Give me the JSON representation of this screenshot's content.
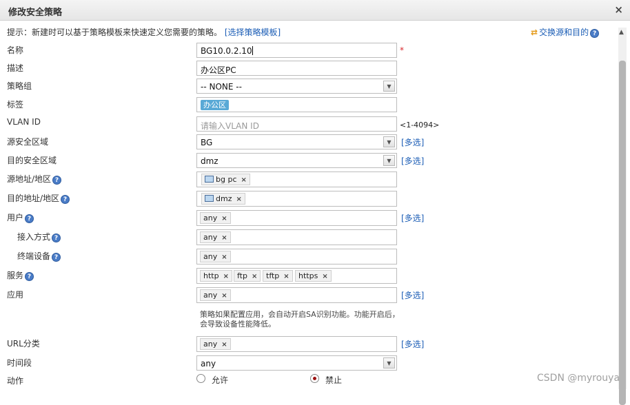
{
  "dialog": {
    "title": "修改安全策略",
    "close_icon": "×"
  },
  "hint": {
    "text": "提示：新建时可以基于策略模板来快速定义您需要的策略。",
    "link": "[选择策略模板]"
  },
  "swap_link": "交换源和目的",
  "help_glyph": "?",
  "fields": {
    "name": {
      "label": "名称",
      "value": "BG10.0.2.10",
      "required": "*"
    },
    "description": {
      "label": "描述",
      "value": "办公区PC"
    },
    "policy_group": {
      "label": "策略组",
      "value": "-- NONE --"
    },
    "tag": {
      "label": "标签",
      "value": "办公区"
    },
    "vlan": {
      "label": "VLAN ID",
      "placeholder": "请输入VLAN ID",
      "range": "<1-4094>"
    },
    "src_zone": {
      "label": "源安全区域",
      "value": "BG",
      "multi": "[多选]"
    },
    "dst_zone": {
      "label": "目的安全区域",
      "value": "dmz",
      "multi": "[多选]"
    },
    "src_addr": {
      "label": "源地址/地区",
      "chips": [
        "bg pc"
      ]
    },
    "dst_addr": {
      "label": "目的地址/地区",
      "chips": [
        "dmz"
      ]
    },
    "user": {
      "label": "用户",
      "chips": [
        "any"
      ],
      "multi": "[多选]"
    },
    "access_mode": {
      "label": "接入方式",
      "chips": [
        "any"
      ]
    },
    "terminal": {
      "label": "终端设备",
      "chips": [
        "any"
      ]
    },
    "service": {
      "label": "服务",
      "chips": [
        "http",
        "ftp",
        "tftp",
        "https"
      ]
    },
    "application": {
      "label": "应用",
      "chips": [
        "any"
      ],
      "multi": "[多选]"
    },
    "app_note": "策略如果配置应用，会自动开启SA识别功能。功能开启后，会导致设备性能降低。",
    "url_category": {
      "label": "URL分类",
      "chips": [
        "any"
      ],
      "multi": "[多选]"
    },
    "time_range": {
      "label": "时间段",
      "value": "any"
    },
    "action": {
      "label": "动作",
      "permit": "允许",
      "deny": "禁止",
      "selected": "deny"
    }
  },
  "chip_close": "×",
  "watermark": "CSDN @myrouya",
  "colors": {
    "link": "#1a5cb5",
    "tag": "#59a9d6",
    "required": "#d8262b"
  }
}
